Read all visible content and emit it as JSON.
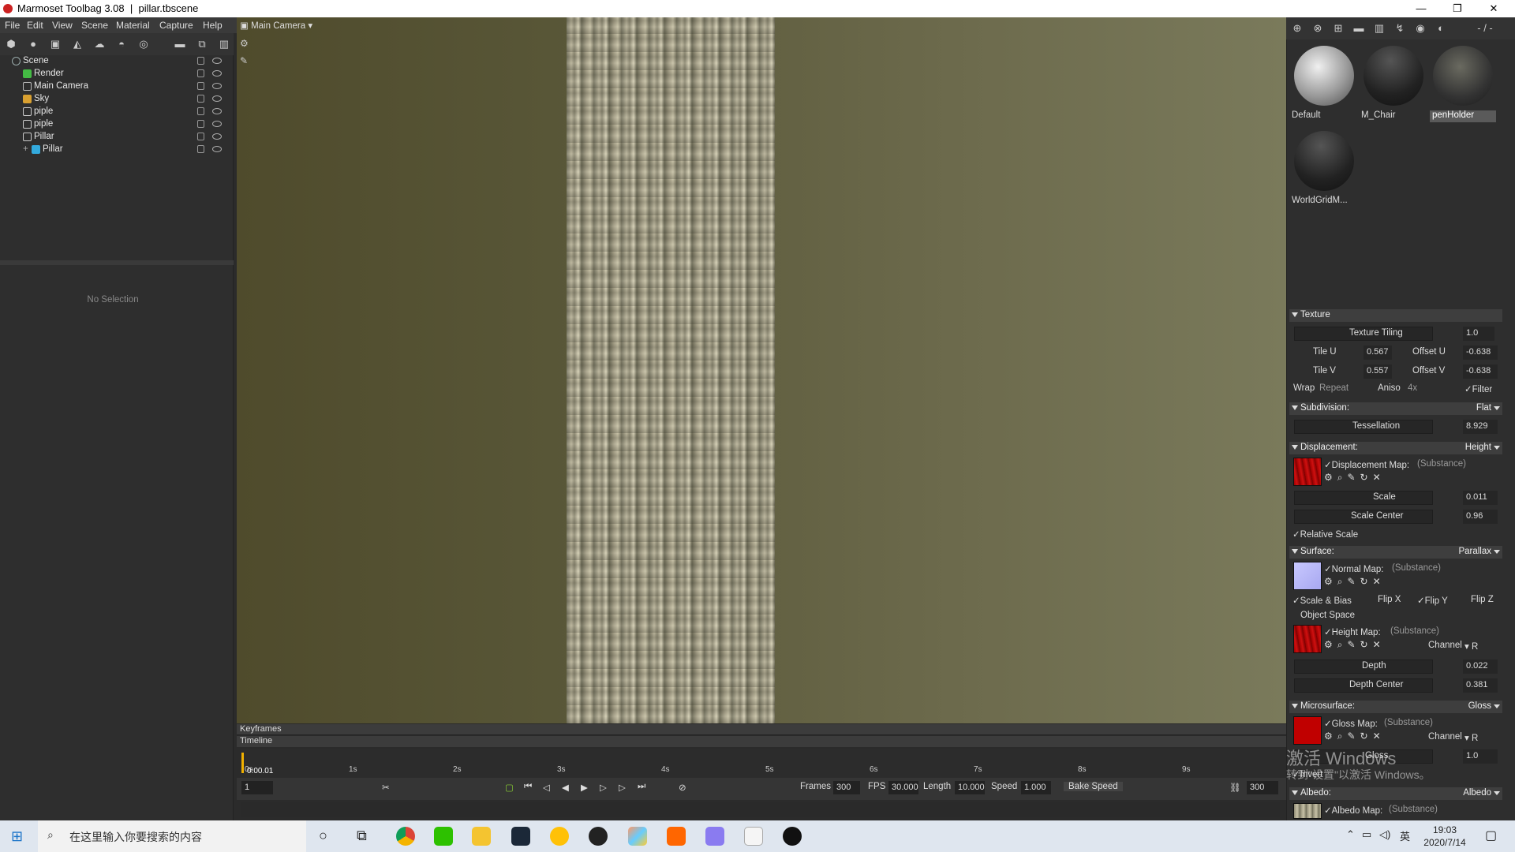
{
  "titlebar": {
    "app": "Marmoset Toolbag 3.08",
    "file": "pillar.tbscene",
    "separator": "|",
    "min": "—",
    "restore": "❐",
    "close": "✕"
  },
  "menu": [
    "File",
    "Edit",
    "View",
    "Scene",
    "Material",
    "Capture",
    "Help"
  ],
  "scene_tree": [
    {
      "label": "Scene",
      "icon": "scene-icon",
      "indent": 0,
      "color": "#9aa"
    },
    {
      "label": "Render",
      "icon": "render-icon",
      "indent": 1,
      "color": "#5c5"
    },
    {
      "label": "Main Camera",
      "icon": "camera-icon",
      "indent": 1,
      "color": "#aaa"
    },
    {
      "label": "Sky",
      "icon": "sky-icon",
      "indent": 1,
      "color": "#e0b040"
    },
    {
      "label": "piple",
      "icon": "light-icon",
      "indent": 1,
      "color": "#ccc"
    },
    {
      "label": "piple",
      "icon": "light-icon",
      "indent": 1,
      "color": "#ccc"
    },
    {
      "label": "Pillar",
      "icon": "object-icon",
      "indent": 1,
      "color": "#ccc"
    },
    {
      "label": "Pillar",
      "icon": "mesh-icon",
      "indent": 2,
      "color": "#3ad"
    }
  ],
  "no_selection": "No Selection",
  "viewport": {
    "camera": "Main Camera"
  },
  "timeline": {
    "keyframes_label": "Keyframes",
    "timeline_label": "Timeline",
    "ticks": [
      "0s",
      "1s",
      "2s",
      "3s",
      "4s",
      "5s",
      "6s",
      "7s",
      "8s",
      "9s"
    ],
    "current_time": "0:00.01",
    "current_frame": "1",
    "frames_label": "Frames",
    "frames": "300",
    "fps_label": "FPS",
    "fps": "30.000",
    "length_label": "Length",
    "length": "10.000",
    "speed_label": "Speed",
    "speed": "1.000",
    "bake_speed": "Bake Speed",
    "end_frame": "300"
  },
  "materials": [
    {
      "name": "Default",
      "style": "light"
    },
    {
      "name": "M_Chair",
      "style": "dark"
    },
    {
      "name": "penHolder",
      "style": "rock",
      "selected": true
    },
    {
      "name": "WorldGridM...",
      "style": "dark"
    }
  ],
  "rtool_right": "- / -",
  "texture": {
    "header": "Texture",
    "tiling_label": "Texture Tiling",
    "tiling": "1.0",
    "tile_u_label": "Tile U",
    "tile_u": "0.567",
    "offset_u_label": "Offset U",
    "offset_u": "-0.638",
    "tile_v_label": "Tile V",
    "tile_v": "0.557",
    "offset_v_label": "Offset V",
    "offset_v": "-0.638",
    "wrap_label": "Wrap",
    "wrap": "Repeat",
    "aniso_label": "Aniso",
    "aniso": "4x",
    "filter": "✓Filter"
  },
  "subdivision": {
    "header": "Subdivision:",
    "mode": "Flat",
    "tess_label": "Tessellation",
    "tess": "8.929"
  },
  "displacement": {
    "header": "Displacement:",
    "mode": "Height",
    "map": "✓Displacement Map:",
    "map_src": "(Substance)",
    "scale_label": "Scale",
    "scale": "0.011",
    "center_label": "Scale Center",
    "center": "0.96",
    "relative": "✓Relative Scale"
  },
  "surface": {
    "header": "Surface:",
    "mode": "Parallax",
    "normal_map": "✓Normal Map:",
    "normal_src": "(Substance)",
    "scale_bias": "✓Scale & Bias",
    "flip_x": "Flip X",
    "flip_y": "✓Flip Y",
    "flip_z": "Flip Z",
    "object_space": "Object Space",
    "height_map": "✓Height Map:",
    "height_src": "(Substance)",
    "channel_label": "Channel",
    "channel": "R",
    "depth_label": "Depth",
    "depth": "0.022",
    "depth_center_label": "Depth Center",
    "depth_center": "0.381"
  },
  "microsurface": {
    "header": "Microsurface:",
    "mode": "Gloss",
    "map": "✓Gloss Map:",
    "map_src": "(Substance)",
    "channel_label": "Channel",
    "channel": "R",
    "gloss_label": "Gloss",
    "gloss": "1.0",
    "invert": "✓Invert"
  },
  "albedo": {
    "header": "Albedo:",
    "mode": "Albedo",
    "map": "✓Albedo Map:",
    "map_src": "(Substance)"
  },
  "watermark": {
    "line1": "激活 Windows",
    "line2": "转到\"设置\"以激活 Windows。"
  },
  "taskbar": {
    "search_placeholder": "在这里输入你要搜索的内容",
    "time": "19:03",
    "date": "2020/7/14",
    "lang": "英"
  },
  "colors": {
    "viewport": "#585637",
    "panel": "#2e2e2e",
    "accent": "#f0b000",
    "swatch_red": "#c00000",
    "swatch_normal": "#b8b8ff"
  }
}
